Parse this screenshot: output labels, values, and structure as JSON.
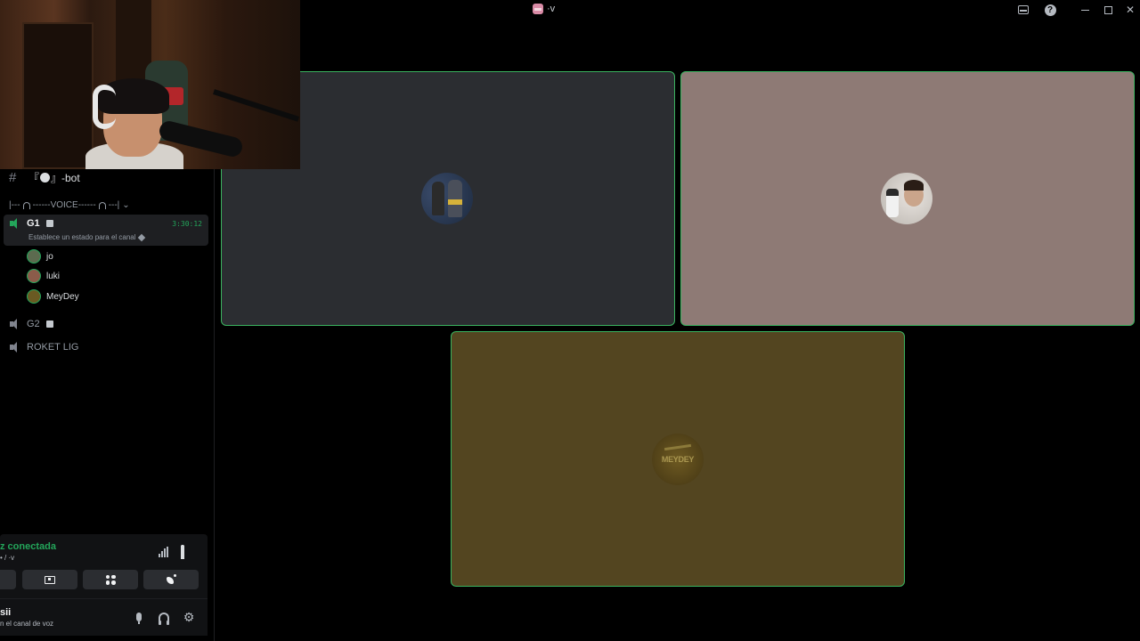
{
  "window": {
    "title": "·v",
    "icons": [
      "server-icon",
      "inbox-icon",
      "help-icon",
      "minimize-icon",
      "maximize-icon",
      "close-icon"
    ]
  },
  "sidebar": {
    "text_channel": {
      "prefix": "『",
      "suffix": "』-bot"
    },
    "category": {
      "left": "|---",
      "middle": "------VOICE------",
      "right": "---|",
      "chevron": "⌄"
    },
    "active_voice_channel": {
      "name": "G1",
      "timer": "3:30:12",
      "status_placeholder": "Establece un estado para el canal",
      "members": [
        {
          "name": "jo"
        },
        {
          "name": "luki"
        },
        {
          "name": "MeyDey"
        }
      ]
    },
    "voice_channels": [
      {
        "name": "G2"
      },
      {
        "name": "ROKET LIG"
      }
    ]
  },
  "rtc_panel": {
    "status": "z conectada",
    "channel": "• / ·v"
  },
  "user_panel": {
    "name": "sii",
    "status": "n el canal de voz"
  },
  "video_grid": {
    "tiles": [
      {
        "avatar": "batman-figures-avatar",
        "speaking": true
      },
      {
        "avatar": "man-with-figure-avatar",
        "speaking": true
      },
      {
        "avatar": "meydey-logo-avatar",
        "speaking": true,
        "logo_text": "MEYDEY"
      }
    ]
  },
  "colors": {
    "accent_green": "#23a55a",
    "tile_border": "#3bb35f",
    "tile_1_bg": "#2b2d31",
    "tile_2_bg": "#8e7a75",
    "tile_3_bg": "#534520"
  }
}
